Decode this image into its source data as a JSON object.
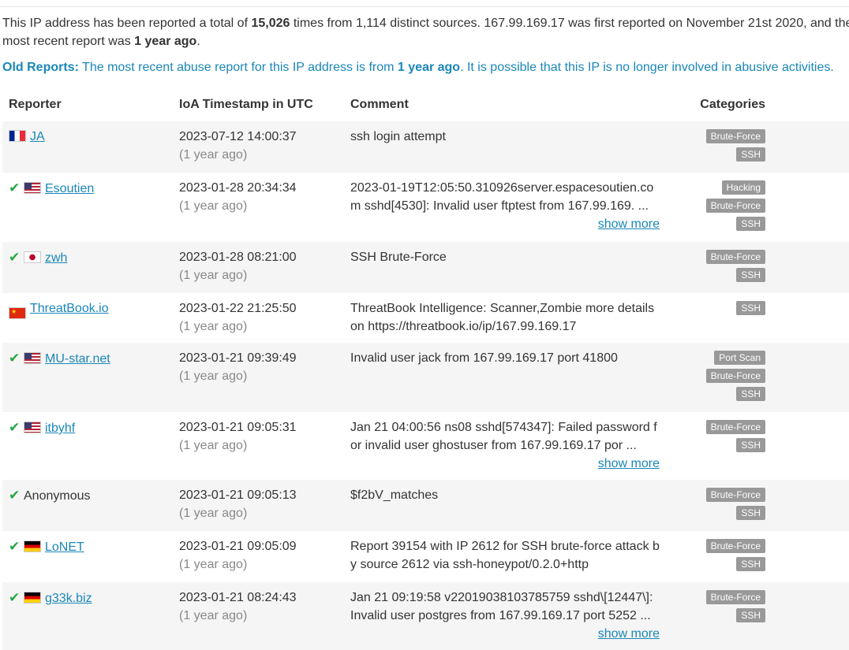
{
  "summary": {
    "p1": "This IP address has been reported a total of ",
    "total": "15,026",
    "p2": " times from 1,114 distinct sources. 167.99.169.17 was first reported on November 21st 2020, and the",
    "p3": "most recent report was ",
    "recent": "1 year ago",
    "p4": "."
  },
  "old_notice": {
    "label": "Old Reports:",
    "p1": " The most recent abuse report for this IP address is from ",
    "recent": "1 year ago",
    "p2": ". It is possible that this IP is no longer involved in abusive activities."
  },
  "columns": {
    "reporter": "Reporter",
    "timestamp": "IoA Timestamp in UTC",
    "comment": "Comment",
    "categories": "Categories"
  },
  "reports": [
    {
      "verified": false,
      "flag": "fr",
      "reporter": "JA",
      "link": true,
      "timestamp": "2023-07-12 14:00:37",
      "ago": "(1 year ago)",
      "comment": "ssh login attempt",
      "show_more": "",
      "categories": [
        "Brute-Force",
        "SSH"
      ]
    },
    {
      "verified": true,
      "flag": "us",
      "reporter": "Esoutien",
      "link": true,
      "timestamp": "2023-01-28 20:34:34",
      "ago": "(1 year ago)",
      "comment": "2023-01-19T12:05:50.310926server.espacesoutien.com sshd[4530]: Invalid user ftptest from 167.99.169. ...",
      "show_more": "show more",
      "categories": [
        "Hacking",
        "Brute-Force",
        "SSH"
      ]
    },
    {
      "verified": true,
      "flag": "jp",
      "reporter": "zwh",
      "link": true,
      "timestamp": "2023-01-28 08:21:00",
      "ago": "(1 year ago)",
      "comment": "SSH Brute-Force",
      "show_more": "",
      "categories": [
        "Brute-Force",
        "SSH"
      ]
    },
    {
      "verified": false,
      "flag": "cn",
      "reporter": "ThreatBook.io",
      "link": true,
      "timestamp": "2023-01-22 21:25:50",
      "ago": "(1 year ago)",
      "comment": "ThreatBook Intelligence: Scanner,Zombie more details on https://threatbook.io/ip/167.99.169.17",
      "show_more": "",
      "categories": [
        "SSH"
      ]
    },
    {
      "verified": true,
      "flag": "us",
      "reporter": "MU-star.net",
      "link": true,
      "timestamp": "2023-01-21 09:39:49",
      "ago": "(1 year ago)",
      "comment": "Invalid user jack from 167.99.169.17 port 41800",
      "show_more": "",
      "categories": [
        "Port Scan",
        "Brute-Force",
        "SSH"
      ]
    },
    {
      "verified": true,
      "flag": "us",
      "reporter": "itbyhf",
      "link": true,
      "timestamp": "2023-01-21 09:05:31",
      "ago": "(1 year ago)",
      "comment": "Jan 21 04:00:56 ns08 sshd[574347]: Failed password for invalid user ghostuser from 167.99.169.17 por ...",
      "show_more": "show more",
      "categories": [
        "Brute-Force",
        "SSH"
      ]
    },
    {
      "verified": true,
      "flag": "",
      "reporter": "Anonymous",
      "link": false,
      "timestamp": "2023-01-21 09:05:13",
      "ago": "(1 year ago)",
      "comment": "$f2bV_matches",
      "show_more": "",
      "categories": [
        "Brute-Force",
        "SSH"
      ]
    },
    {
      "verified": true,
      "flag": "de",
      "reporter": "LoNET",
      "link": true,
      "timestamp": "2023-01-21 09:05:09",
      "ago": "(1 year ago)",
      "comment": "Report 39154 with IP 2612 for SSH brute-force attack by source 2612 via ssh-honeypot/0.2.0+http",
      "show_more": "",
      "categories": [
        "Brute-Force",
        "SSH"
      ]
    },
    {
      "verified": true,
      "flag": "de",
      "reporter": "g33k.biz",
      "link": true,
      "timestamp": "2023-01-21 08:24:43",
      "ago": "(1 year ago)",
      "comment": "Jan 21 09:19:58 v22019038103785759 sshd\\[12447\\]: Invalid user postgres from 167.99.169.17 port 5252 ...",
      "show_more": "show more",
      "categories": [
        "Brute-Force",
        "SSH"
      ]
    }
  ],
  "colors": {
    "link": "#1a87b8",
    "badge": "#999999",
    "check": "#28a745",
    "row_alt": "#f5f5f5"
  }
}
